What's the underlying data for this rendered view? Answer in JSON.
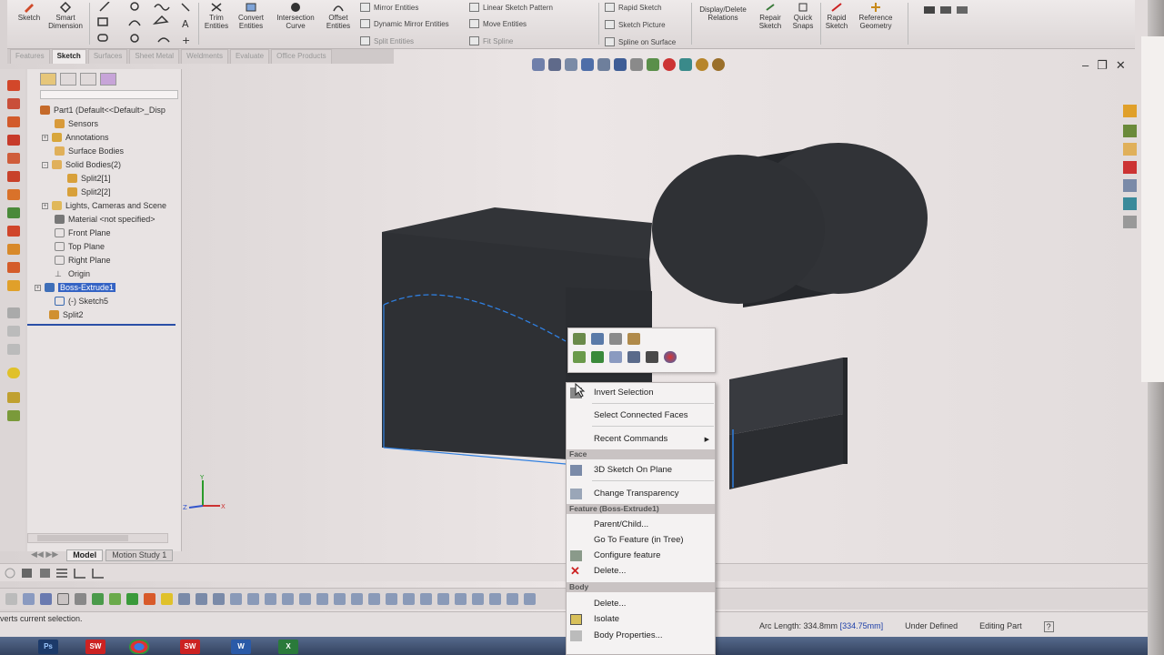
{
  "ribbon": {
    "sketch": "Sketch",
    "smart_dimension": "Smart Dimension",
    "trim_entities": "Trim Entities",
    "convert_entities": "Convert Entities",
    "intersection_curve": "Intersection Curve",
    "offset_entities": "Offset Entities",
    "mirror_entities": "Mirror Entities",
    "dynamic_mirror": "Dynamic Mirror Entities",
    "split_entities": "Split Entities",
    "linear_pattern": "Linear Sketch Pattern",
    "move_entities": "Move Entities",
    "fit_spline": "Fit Spline",
    "rapid_sketch_top": "Rapid Sketch",
    "sketch_picture": "Sketch Picture",
    "spline_on_surface": "Spline on Surface",
    "display_delete_relations": "Display/Delete Relations",
    "repair_sketch": "Repair Sketch",
    "quick_snaps": "Quick Snaps",
    "rapid_sketch": "Rapid Sketch",
    "reference_geometry": "Reference Geometry"
  },
  "tabs": [
    "Features",
    "Sketch",
    "Surfaces",
    "Sheet Metal",
    "Weldments",
    "Evaluate",
    "Office Products"
  ],
  "active_tab": "Sketch",
  "tree": {
    "part": "Part1  (Default<<Default>_Disp",
    "sensors": "Sensors",
    "annotations": "Annotations",
    "surface_bodies": "Surface Bodies",
    "solid_bodies": "Solid Bodies(2)",
    "split1": "Split2[1]",
    "split2": "Split2[2]",
    "lights": "Lights, Cameras and Scene",
    "material": "Material <not specified>",
    "front": "Front Plane",
    "top": "Top Plane",
    "right": "Right Plane",
    "origin": "Origin",
    "boss": "Boss-Extrude1",
    "sketch5": "(-) Sketch5",
    "split": "Split2"
  },
  "triad": {
    "y": "Y",
    "x": "X",
    "z": "Z"
  },
  "model_tabs": [
    "Model",
    "Motion Study 1"
  ],
  "context_menu": {
    "invert": "Invert Selection",
    "connected": "Select Connected Faces",
    "recent": "Recent Commands",
    "hdr_face": "Face",
    "sketch3d": "3D Sketch On Plane",
    "transparency": "Change Transparency",
    "hdr_feature": "Feature (Boss-Extrude1)",
    "parent": "Parent/Child...",
    "goto": "Go To Feature (in Tree)",
    "configure": "Configure feature",
    "delete1": "Delete...",
    "hdr_body": "Body",
    "delete2": "Delete...",
    "isolate": "Isolate",
    "body_props": "Body Properties..."
  },
  "status": {
    "message": "verts current selection.",
    "arc_label": "Arc Length: 334.8mm",
    "arc_value": "[334.75mm]",
    "state": "Under Defined",
    "mode": "Editing Part"
  },
  "taskbar": {
    "ps": "Ps",
    "sw": "SW",
    "word": "W",
    "excel": "X"
  },
  "colors": {
    "selection": "#3463c4",
    "model": "#2f3135",
    "edge_highlight": "#2f7fe0"
  }
}
